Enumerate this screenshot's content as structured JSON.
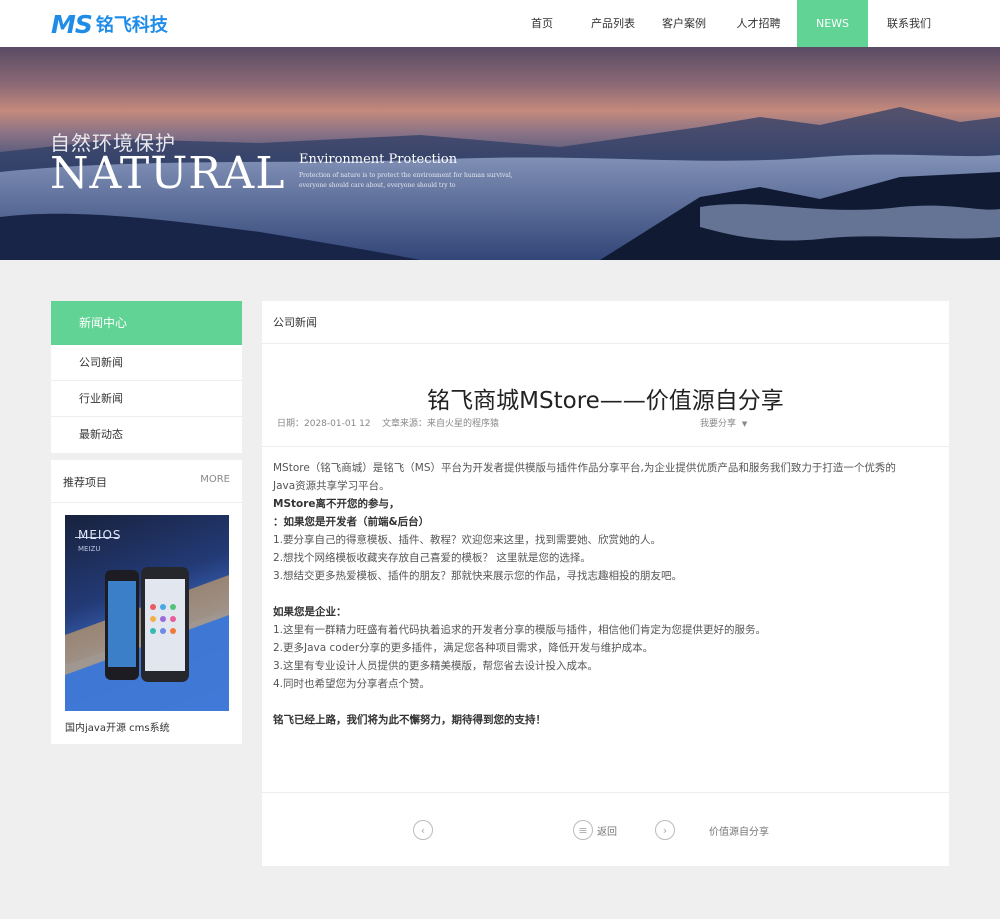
{
  "header": {
    "logo_mark": "MS",
    "logo_text": "铭飞科技",
    "nav": [
      {
        "label": "首页",
        "active": false
      },
      {
        "label": "产品列表",
        "active": false
      },
      {
        "label": "客户案例",
        "active": false
      },
      {
        "label": "人才招聘",
        "active": false
      },
      {
        "label": "NEWS",
        "active": true
      },
      {
        "label": "联系我们",
        "active": false
      }
    ]
  },
  "banner": {
    "cn_title": "自然环境保护",
    "big_title": "NATURAL",
    "env_title": "Environment Protection",
    "sub_line1": "Protection of nature is to protect the environment for human survival,",
    "sub_line2": "everyone should care about, everyone should try to"
  },
  "sidebar": {
    "heading": "新闻中心",
    "items": [
      {
        "label": "公司新闻"
      },
      {
        "label": "行业新闻"
      },
      {
        "label": "最新动态"
      }
    ],
    "recommend": {
      "title": "推荐项目",
      "more": "MORE",
      "image_brand": "MEIOS",
      "image_brand2": "MEIZU",
      "caption": "国内java开源 cms系统"
    }
  },
  "main": {
    "breadcrumb": "公司新闻",
    "title": "铭飞商城MStore——价值源自分享",
    "meta": "日期：2028-01-01 12    文章来源：来自火星的程序猿",
    "share": "我要分享",
    "body": [
      {
        "text": "MStore（铭飞商城）是铭飞（MS）平台为开发者提供模版与插件作品分享平台,为企业提供优质产品和服务我们致力于打造一个优秀的",
        "bold": false
      },
      {
        "text": "Java资源共享学习平台。",
        "bold": false
      },
      {
        "text": "MStore离不开您的参与，",
        "bold": true
      },
      {
        "text": "：如果您是开发者（前端&后台）",
        "bold": true
      },
      {
        "text": "1.要分享自己的得意模板、插件、教程？欢迎您来这里，找到需要她、欣赏她的人。",
        "bold": false
      },
      {
        "text": "2.想找个网络模板收藏夹存放自己喜爱的模板？ 这里就是您的选择。",
        "bold": false
      },
      {
        "text": "3.想结交更多热爱模板、插件的朋友？那就快来展示您的作品，寻找志趣相投的朋友吧。",
        "bold": false
      },
      {
        "text": "",
        "bold": false
      },
      {
        "text": "如果您是企业：",
        "bold": true
      },
      {
        "text": "1.这里有一群精力旺盛有着代码执着追求的开发者分享的模版与插件，相信他们肯定为您提供更好的服务。",
        "bold": false
      },
      {
        "text": "2.更多Java coder分享的更多插件，满足您各种项目需求，降低开发与维护成本。",
        "bold": false
      },
      {
        "text": "3.这里有专业设计人员提供的更多精美模版，帮您省去设计投入成本。",
        "bold": false
      },
      {
        "text": "4.同时也希望您为分享者点个赞。",
        "bold": false
      },
      {
        "text": "",
        "bold": false
      },
      {
        "text": "铭飞已经上路，我们将为此不懈努力，期待得到您的支持！",
        "bold": true
      }
    ],
    "pager": {
      "back_label": "返回",
      "next_label": "价值源自分享"
    }
  }
}
